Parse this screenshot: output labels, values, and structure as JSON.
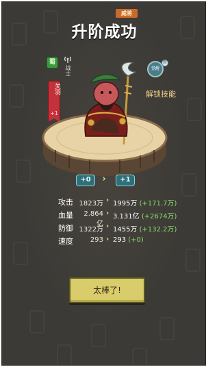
{
  "header": {
    "badge": "威将",
    "title": "升阶成功"
  },
  "hero": {
    "tag": "蜀",
    "role": "战士",
    "name": "关羽",
    "name_plus": "+1"
  },
  "skill": {
    "icon_text": "觉醒",
    "corner": "新",
    "label": "解锁技能"
  },
  "level": {
    "from": "+0",
    "to": "+1"
  },
  "stats": [
    {
      "label": "攻击",
      "old": "1823万",
      "new": "1995万",
      "delta": "(+171.7万)"
    },
    {
      "label": "血量",
      "old": "2.864亿",
      "new": "3.131亿",
      "delta": "(+2674万)"
    },
    {
      "label": "防御",
      "old": "1322万",
      "new": "1455万",
      "delta": "(+132.2万)"
    },
    {
      "label": "速度",
      "old": "293",
      "new": "293",
      "delta": "(+0)"
    }
  ],
  "button": {
    "label": "太棒了!"
  },
  "icons": {
    "role": "antenna-icon",
    "arrow": "chevron-right-icon"
  }
}
